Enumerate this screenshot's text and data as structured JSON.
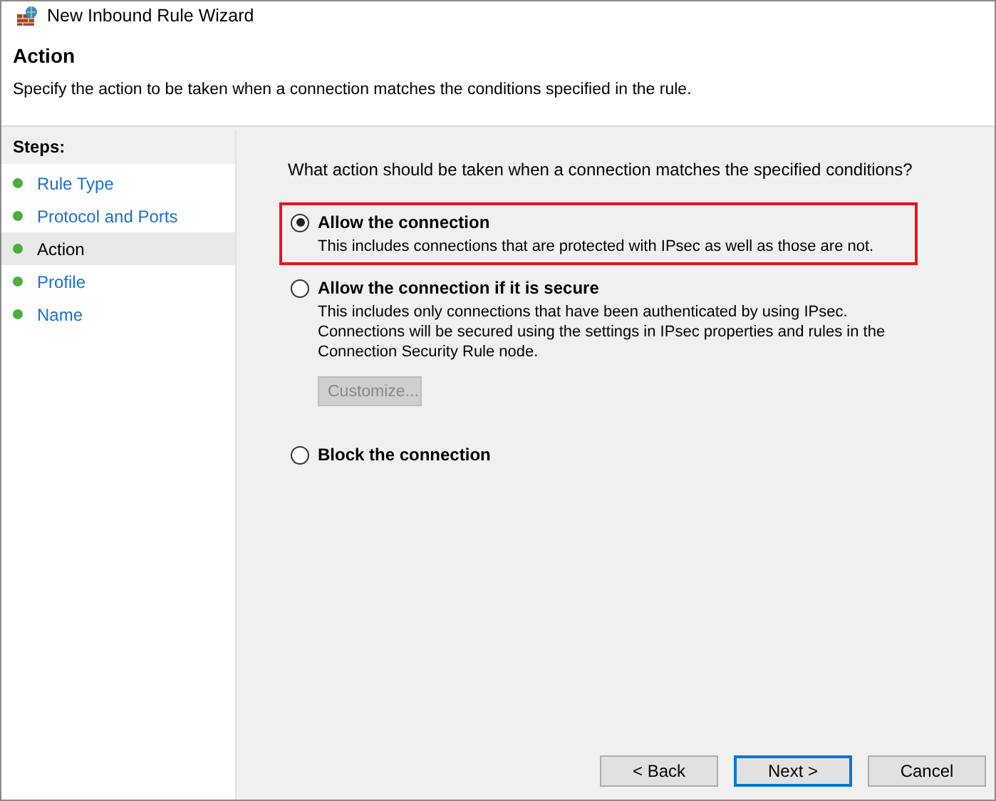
{
  "window": {
    "title": "New Inbound Rule Wizard"
  },
  "header": {
    "title": "Action",
    "subtitle": "Specify the action to be taken when a connection matches the conditions specified in the rule."
  },
  "steps": {
    "heading": "Steps:",
    "items": [
      {
        "label": "Rule Type",
        "selected": false
      },
      {
        "label": "Protocol and Ports",
        "selected": false
      },
      {
        "label": "Action",
        "selected": true
      },
      {
        "label": "Profile",
        "selected": false
      },
      {
        "label": "Name",
        "selected": false
      }
    ]
  },
  "question": "What action should be taken when a connection matches the specified conditions?",
  "options": [
    {
      "label": "Allow the connection",
      "description": "This includes connections that are protected with IPsec as well as those are not.",
      "selected": true,
      "highlighted": true
    },
    {
      "label": "Allow the connection if it is secure",
      "description": "This includes only connections that have been authenticated by using IPsec.  Connections will be secured using the settings in IPsec properties and rules in the Connection Security Rule node.",
      "selected": false,
      "highlighted": false,
      "button": {
        "label": "Customize...",
        "disabled": true
      }
    },
    {
      "label": "Block the connection",
      "selected": false,
      "highlighted": false
    }
  ],
  "buttons": [
    {
      "label": "< Back",
      "default": false
    },
    {
      "label": "Next >",
      "default": true
    },
    {
      "label": "Cancel",
      "default": false
    }
  ]
}
